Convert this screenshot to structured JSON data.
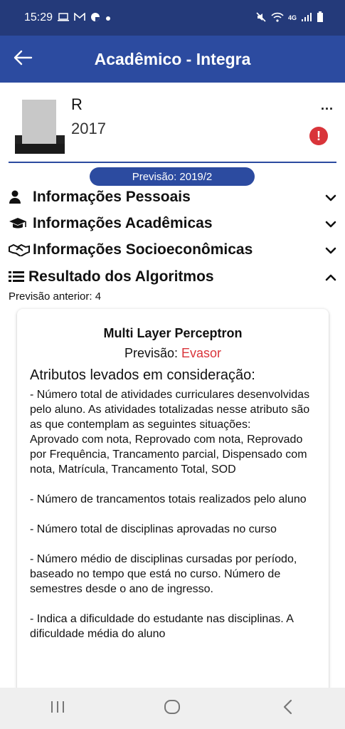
{
  "status_bar": {
    "time": "15:29",
    "network_label": "4G"
  },
  "app_bar": {
    "title": "Acadêmico - Integra"
  },
  "profile": {
    "name": "R",
    "year": "2017",
    "more_label": "...",
    "alert_label": "!"
  },
  "prediction_pill": "Previsão: 2019/2",
  "sections": [
    {
      "label": "Informações Pessoais",
      "icon": "person-icon",
      "chevron": "chevron-down-icon"
    },
    {
      "label": "Informações Acadêmicas",
      "icon": "graduation-cap-icon",
      "chevron": "chevron-down-icon"
    },
    {
      "label": "Informações Socioeconômicas",
      "icon": "handshake-icon",
      "chevron": "chevron-down-icon"
    },
    {
      "label": "Resultado dos Algoritmos",
      "icon": "list-icon",
      "chevron": "chevron-up-icon"
    }
  ],
  "previous_prediction": "Previsão anterior: 4",
  "card": {
    "title": "Multi Layer Perceptron",
    "prediction_label": "Previsão: ",
    "prediction_value": "Evasor",
    "attributes_title": "Atributos levados em consideração:",
    "attributes": [
      "- Número total de atividades curriculares desenvolvidas pelo aluno. As atividades totalizadas nesse atributo são as que contemplam as seguintes situações:\nAprovado com nota, Reprovado com nota, Reprovado por Frequência, Trancamento parcial, Dispensado com nota, Matrícula, Trancamento Total, SOD",
      "- Número de trancamentos totais realizados pelo aluno",
      "- Número total de disciplinas aprovadas no curso",
      "- Número médio de disciplinas cursadas por período, baseado no tempo que está no curso. Número de semestres desde o ano de ingresso.",
      "- Indica a dificuldade do estudante nas disciplinas. A dificuldade média do aluno"
    ]
  },
  "colors": {
    "status_bar": "#243a7a",
    "app_bar": "#2c4ba0",
    "accent_red": "#d9343a"
  }
}
